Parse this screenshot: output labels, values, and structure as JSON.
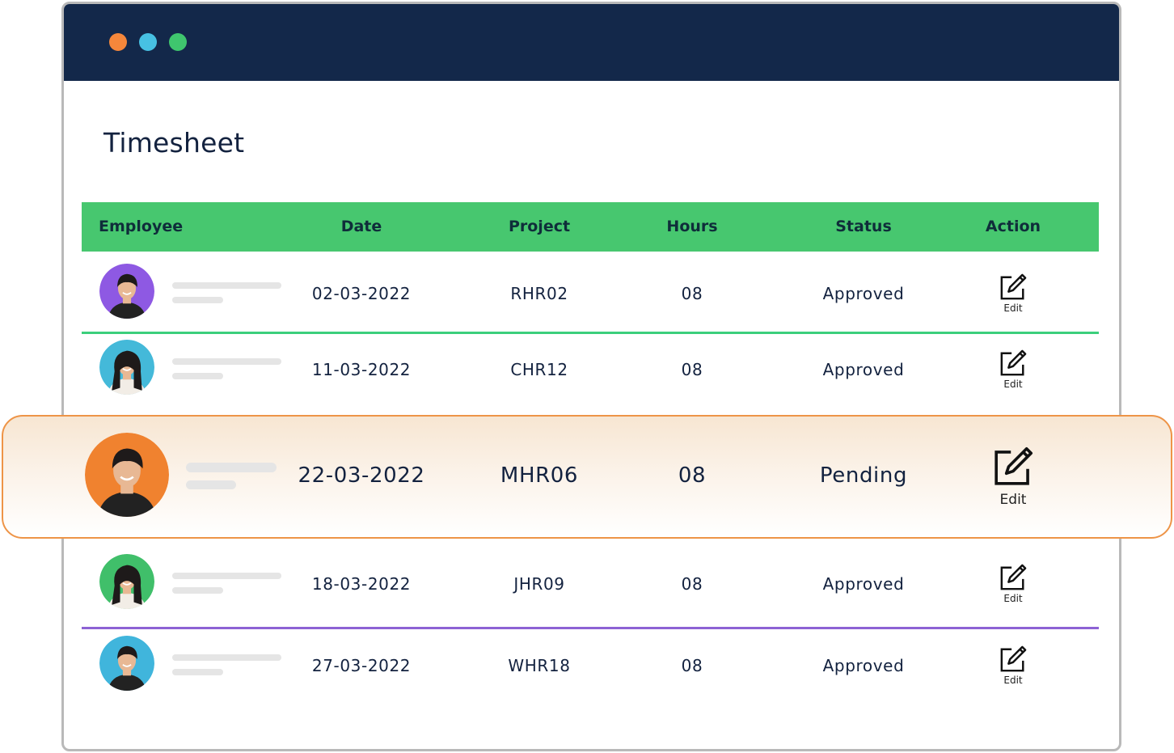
{
  "window": {
    "controls": [
      {
        "name": "close",
        "color": "#f5873b"
      },
      {
        "name": "minimize",
        "color": "#47c1e3"
      },
      {
        "name": "maximize",
        "color": "#3fc66e"
      }
    ],
    "titlebar_color": "#13284a"
  },
  "page": {
    "title": "Timesheet"
  },
  "table": {
    "header_color": "#47c76f",
    "columns": [
      "Employee",
      "Date",
      "Project",
      "Hours",
      "Status",
      "Action"
    ],
    "rows": [
      {
        "avatar_icon": "avatar-man-icon",
        "avatar_bg": "#8e59e3",
        "date": "02-03-2022",
        "project": "RHR02",
        "hours": "08",
        "status": "Approved",
        "action": "Edit",
        "divider_color": "#3ccf7c"
      },
      {
        "avatar_icon": "avatar-woman-icon",
        "avatar_bg": "#44b9d9",
        "date": "11-03-2022",
        "project": "CHR12",
        "hours": "08",
        "status": "Approved",
        "action": "Edit",
        "divider_color": ""
      },
      {
        "avatar_icon": "avatar-man-icon",
        "avatar_bg": "#f0822f",
        "date": "22-03-2022",
        "project": "MHR06",
        "hours": "08",
        "status": "Pending",
        "action": "Edit",
        "highlighted": true,
        "highlight_border": "#ee9447"
      },
      {
        "avatar_icon": "avatar-woman-icon",
        "avatar_bg": "#40bf6a",
        "date": "18-03-2022",
        "project": "JHR09",
        "hours": "08",
        "status": "Approved",
        "action": "Edit",
        "divider_color": "#8d62d4"
      },
      {
        "avatar_icon": "avatar-man-icon",
        "avatar_bg": "#40b5dc",
        "date": "27-03-2022",
        "project": "WHR18",
        "hours": "08",
        "status": "Approved",
        "action": "Edit",
        "divider_color": ""
      }
    ]
  }
}
